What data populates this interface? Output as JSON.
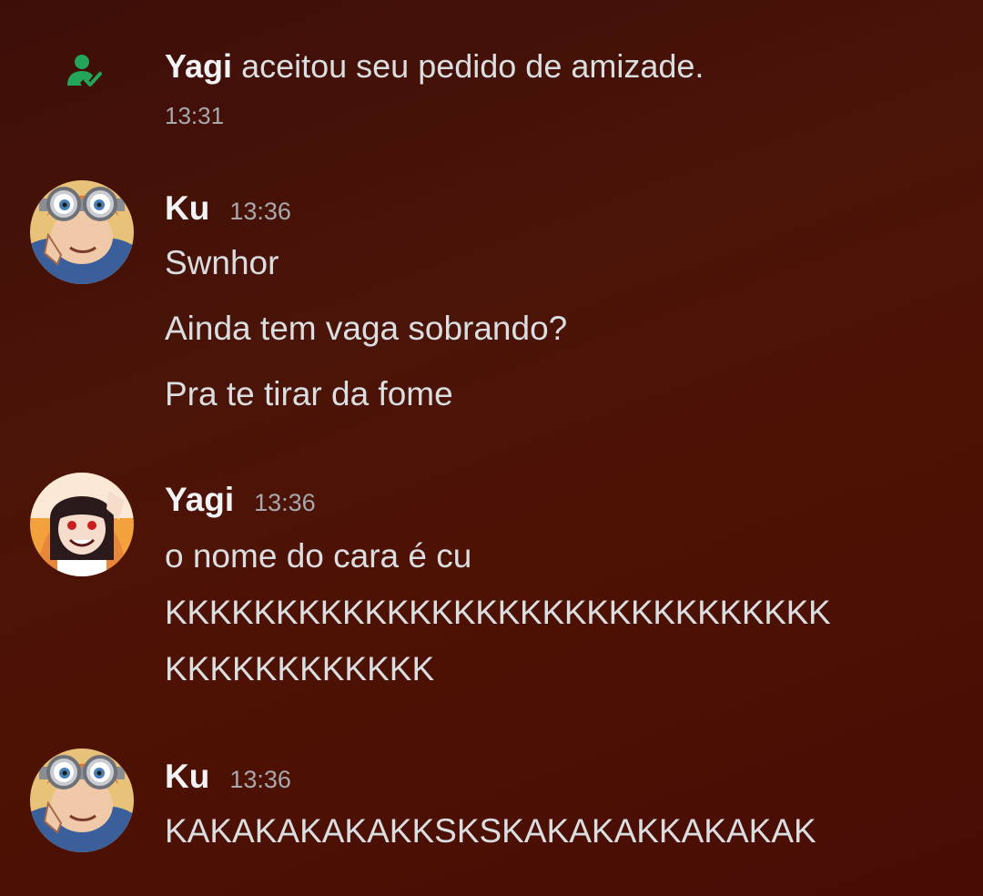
{
  "system_message": {
    "name": "Yagi",
    "text": "aceitou seu pedido de amizade.",
    "time": "13:31",
    "icon": "friend-added-icon",
    "icon_color": "#23a55a"
  },
  "messages": [
    {
      "author": "Ku",
      "time": "13:36",
      "lines": [
        "Swnhor",
        "Ainda tem vaga sobrando?",
        "Pra te tirar da fome"
      ]
    },
    {
      "author": "Yagi",
      "time": "13:36",
      "lines": [
        "o nome do cara é cu",
        "KKKKKKKKKKKKKKKKKKKKKKKKKKKKKK",
        "KKKKKKKKKKKK"
      ]
    },
    {
      "author": "Ku",
      "time": "13:36",
      "lines": [
        "KAKAKAKAKAKKSKSKAKAKAKKAKAKAK"
      ]
    }
  ],
  "colors": {
    "background_top": "#3d0e08",
    "background_bottom": "#480c05",
    "text": "#dbdee1",
    "username": "#f2f3f5",
    "muted": "#a7a9ad"
  }
}
